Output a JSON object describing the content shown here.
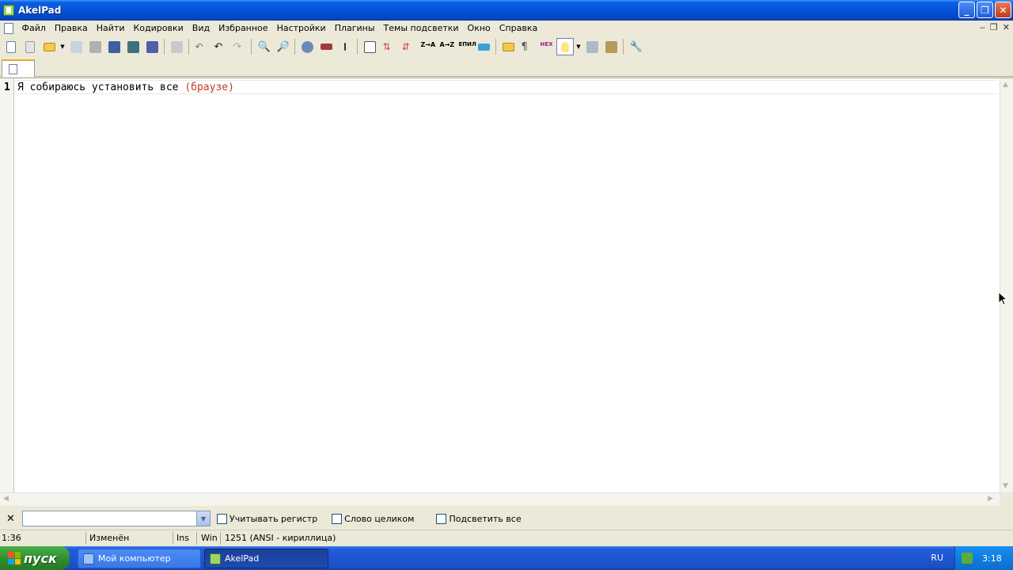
{
  "window": {
    "title": "AkelPad"
  },
  "menu": [
    "Файл",
    "Правка",
    "Найти",
    "Кодировки",
    "Вид",
    "Избранное",
    "Настройки",
    "Плагины",
    "Темы подсветки",
    "Окно",
    "Справка"
  ],
  "editor": {
    "line_number": "1",
    "text_before": "Я собираюсь установить все ",
    "text_paren": "(браузе)"
  },
  "findbar": {
    "close": "✕",
    "search_value": "",
    "options": [
      "Учитывать регистр",
      "Слово целиком",
      "Подсветить все"
    ]
  },
  "status": {
    "position": "1:36",
    "modified": "Изменён",
    "insert_mode": "Ins",
    "newline": "Win",
    "encoding": "1251  (ANSI - кириллица)"
  },
  "taskbar": {
    "start_label": "пуск",
    "tasks": [
      "Мой компьютер",
      "AkelPad"
    ],
    "language": "RU",
    "clock": "3:18"
  }
}
